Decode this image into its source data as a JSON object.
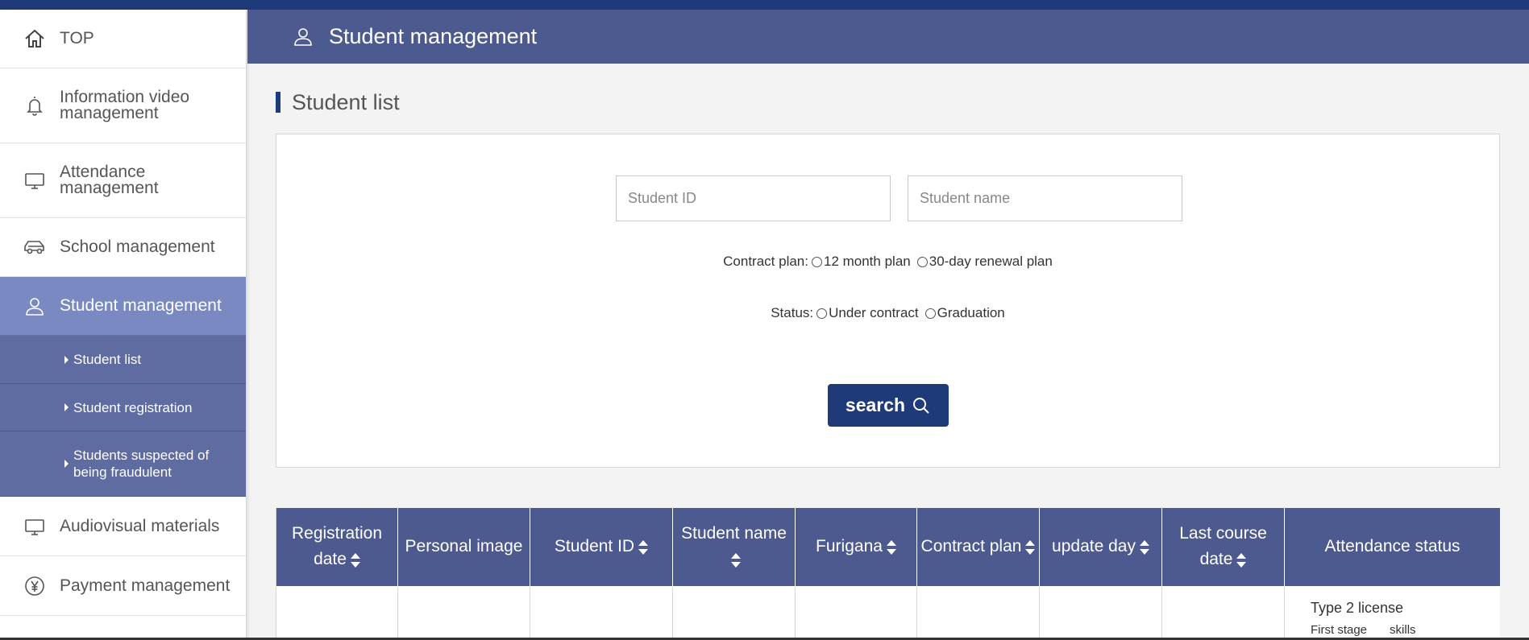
{
  "sidebar": {
    "items": [
      {
        "label": "TOP",
        "icon": "home-icon"
      },
      {
        "label": "Information video management",
        "icon": "bell-icon"
      },
      {
        "label": "Attendance management",
        "icon": "monitor-icon"
      },
      {
        "label": "School management",
        "icon": "car-icon"
      },
      {
        "label": "Student management",
        "icon": "user-icon",
        "active": true
      },
      {
        "label": "Audiovisual materials",
        "icon": "monitor-icon"
      },
      {
        "label": "Payment management",
        "icon": "yen-icon"
      }
    ],
    "subitems": [
      {
        "label": "Student list"
      },
      {
        "label": "Student registration"
      },
      {
        "label": "Students suspected of being fraudulent"
      }
    ]
  },
  "header": {
    "title": "Student management",
    "icon": "user-icon"
  },
  "section": {
    "title": "Student list"
  },
  "search": {
    "student_id_placeholder": "Student ID",
    "student_name_placeholder": "Student name",
    "contract_plan_label": "Contract plan:",
    "contract_options": [
      "12 month plan",
      "30-day renewal plan"
    ],
    "status_label": "Status:",
    "status_options": [
      "Under contract",
      "Graduation"
    ],
    "button_label": "search",
    "button_icon": "search-icon"
  },
  "table": {
    "headers": [
      "Registration date",
      "Personal image",
      "Student ID",
      "Student name",
      "Furigana",
      "Contract plan",
      "update day",
      "Last course date",
      "Attendance status"
    ],
    "sortable": [
      true,
      false,
      true,
      true,
      true,
      true,
      true,
      true,
      false
    ],
    "rows": [
      {
        "attendance_line1": "Type 2 license",
        "attendance_line2a": "First stage",
        "attendance_line2b": "skills"
      }
    ]
  },
  "colors": {
    "topbar": "#1f3a78",
    "header": "#4d5a90",
    "sidebar_active": "#7a89c1",
    "sidebar_sub": "#5e6ca2",
    "button": "#1f3a78"
  }
}
